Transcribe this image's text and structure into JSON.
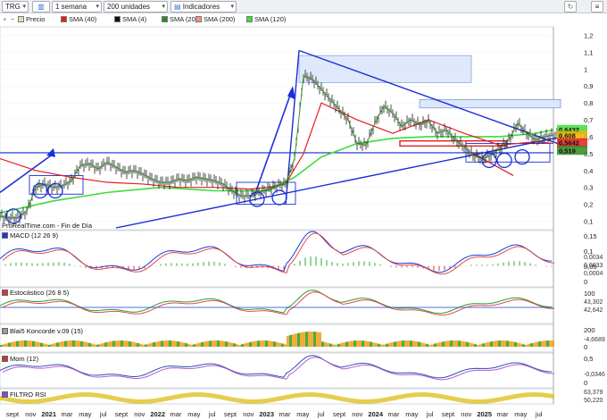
{
  "toolbar": {
    "symbol": "TRG",
    "period": "1 semana",
    "units": "200 unidades",
    "indicators": "Indicadores",
    "icons": [
      "refresh-icon",
      "menu-icon"
    ]
  },
  "legend": [
    {
      "label": "Precio",
      "color": "#d8e4b8"
    },
    {
      "label": "SMA (40)",
      "color": "#e02020"
    },
    {
      "label": "SMA (4)",
      "color": "#111111"
    },
    {
      "label": "SMA (20)",
      "color": "#2e8b22"
    },
    {
      "label": "SMA (200)",
      "color": "#f0908a"
    },
    {
      "label": "SMA (120)",
      "color": "#3ddc3d"
    }
  ],
  "watermark": "ProRealTime.com - Fin de Día",
  "panels": {
    "macd": "MACD (12 26 9)",
    "stoch": "Estocástico (26 8 5)",
    "blai": "Blai5 Koncorde v.09 (15)",
    "mom": "Mom (12)",
    "rsi": "FILTRO RSI"
  },
  "chart_data": {
    "type": "line",
    "price_axis": {
      "ylim": [
        0.05,
        1.25
      ],
      "ticks": [
        1.2,
        1.1,
        1,
        0.9,
        0.8,
        0.7,
        0.6,
        0.5,
        0.4,
        0.3,
        0.2,
        0.1
      ],
      "tick_labels": [
        "1,2",
        "1,1",
        "1",
        "0,9",
        "0,8",
        "0,7",
        "0,6",
        "0,5",
        "0,4",
        "0,3",
        "0,2",
        "0,1"
      ]
    },
    "price_markers": [
      {
        "value": 0.6432,
        "label": "0,6432",
        "color": "#3ddc3d"
      },
      {
        "value": 0.608,
        "label": "0,608",
        "color": "#f0b000"
      },
      {
        "value": 0.5642,
        "label": "0,5642",
        "color": "#e02020"
      },
      {
        "value": 0.519,
        "label": "0,519",
        "color": "#2e8b22"
      }
    ],
    "x_labels": [
      "sept",
      "nov",
      "2021",
      "mar",
      "may",
      "jul",
      "sept",
      "nov",
      "2022",
      "mar",
      "may",
      "jul",
      "sept",
      "nov",
      "2023",
      "mar",
      "may",
      "jul",
      "sept",
      "nov",
      "2024",
      "mar",
      "may",
      "jul",
      "sept",
      "nov",
      "2025",
      "mar",
      "may",
      "jul"
    ],
    "x_bold": [
      "2021",
      "2022",
      "2023",
      "2024",
      "2025"
    ],
    "price": {
      "x": [
        0,
        10,
        20,
        30,
        40,
        50,
        60,
        70,
        80,
        90,
        100,
        110,
        120,
        130,
        140,
        150,
        160,
        170,
        180,
        190,
        200,
        210,
        220,
        230,
        240,
        250,
        260,
        270,
        280,
        290,
        300,
        310,
        320,
        330,
        340,
        350,
        360,
        370,
        380,
        390,
        400,
        410,
        420,
        430,
        440,
        450,
        460,
        470,
        480,
        490,
        500,
        510,
        520,
        530,
        540,
        550,
        560,
        570,
        580,
        590,
        600,
        610,
        620
      ],
      "y": [
        0.13,
        0.12,
        0.12,
        0.16,
        0.3,
        0.32,
        0.3,
        0.31,
        0.34,
        0.43,
        0.44,
        0.41,
        0.45,
        0.42,
        0.39,
        0.4,
        0.38,
        0.35,
        0.33,
        0.33,
        0.35,
        0.34,
        0.36,
        0.35,
        0.34,
        0.32,
        0.28,
        0.25,
        0.25,
        0.27,
        0.29,
        0.31,
        0.32,
        0.47,
        0.96,
        0.94,
        0.88,
        0.82,
        0.76,
        0.7,
        0.56,
        0.55,
        0.68,
        0.78,
        0.74,
        0.66,
        0.7,
        0.67,
        0.69,
        0.62,
        0.64,
        0.58,
        0.54,
        0.49,
        0.47,
        0.49,
        0.53,
        0.58,
        0.68,
        0.62,
        0.58,
        0.6,
        0.61
      ]
    },
    "sma_40": {
      "x": [
        0,
        40,
        80,
        120,
        160,
        200,
        240,
        280,
        300,
        320,
        340,
        360,
        400,
        440,
        480,
        520,
        560,
        600,
        620
      ],
      "y": [
        0.47,
        0.4,
        0.36,
        0.33,
        0.32,
        0.3,
        0.3,
        0.29,
        0.3,
        0.32,
        0.5,
        0.8,
        0.7,
        0.62,
        0.7,
        0.62,
        0.55,
        0.57,
        0.56
      ]
    },
    "sma_120": {
      "x": [
        0,
        60,
        120,
        180,
        240,
        300,
        330,
        360,
        400,
        440,
        480,
        520,
        560,
        600,
        620
      ],
      "y": [
        0.15,
        0.22,
        0.27,
        0.3,
        0.28,
        0.28,
        0.36,
        0.48,
        0.56,
        0.59,
        0.6,
        0.6,
        0.6,
        0.62,
        0.64
      ]
    },
    "macd": {
      "ylim": [
        -0.05,
        0.16
      ],
      "ticks": [
        0.15,
        0.1,
        0.05,
        0
      ],
      "tick_labels": [
        "0,15",
        "0,1",
        "0,05",
        "0"
      ],
      "markers": [
        "0,0034",
        "0,0033",
        "0,0004"
      ]
    },
    "stoch": {
      "ylim": [
        0,
        100
      ],
      "ticks": [
        100
      ],
      "tick_labels": [
        "100"
      ],
      "markers": [
        "43,302",
        "42,642"
      ]
    },
    "blai": {
      "ticks": [
        200,
        0
      ],
      "tick_labels": [
        "200",
        "0"
      ],
      "markers": [
        "-4,6689"
      ]
    },
    "mom": {
      "ticks": [
        0.5,
        0
      ],
      "tick_labels": [
        "0,5",
        "0"
      ],
      "markers": [
        "-0,0346"
      ]
    },
    "rsi": {
      "markers": [
        "63,379",
        "50,220"
      ]
    }
  }
}
